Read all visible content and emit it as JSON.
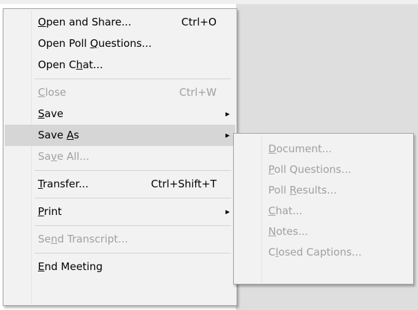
{
  "main_menu": [
    {
      "type": "item",
      "pre": "",
      "key": "O",
      "post": "pen and Share...",
      "shortcut": "Ctrl+O",
      "submenu": false,
      "disabled": false,
      "name": "menu-item-open-and-share"
    },
    {
      "type": "item",
      "pre": "Open Poll ",
      "key": "Q",
      "post": "uestions...",
      "shortcut": "",
      "submenu": false,
      "disabled": false,
      "name": "menu-item-open-poll-questions"
    },
    {
      "type": "item",
      "pre": "Open C",
      "key": "h",
      "post": "at...",
      "shortcut": "",
      "submenu": false,
      "disabled": false,
      "name": "menu-item-open-chat"
    },
    {
      "type": "separator"
    },
    {
      "type": "item",
      "pre": "",
      "key": "C",
      "post": "lose",
      "shortcut": "Ctrl+W",
      "submenu": false,
      "disabled": true,
      "name": "menu-item-close"
    },
    {
      "type": "item",
      "pre": "",
      "key": "S",
      "post": "ave",
      "shortcut": "",
      "submenu": true,
      "disabled": false,
      "name": "menu-item-save"
    },
    {
      "type": "item",
      "pre": "Save ",
      "key": "A",
      "post": "s",
      "shortcut": "",
      "submenu": true,
      "disabled": false,
      "hover": true,
      "name": "menu-item-save-as"
    },
    {
      "type": "item",
      "pre": "Sa",
      "key": "v",
      "post": "e All...",
      "shortcut": "",
      "submenu": false,
      "disabled": true,
      "name": "menu-item-save-all"
    },
    {
      "type": "separator"
    },
    {
      "type": "item",
      "pre": "",
      "key": "T",
      "post": "ransfer...",
      "shortcut": "Ctrl+Shift+T",
      "submenu": false,
      "disabled": false,
      "name": "menu-item-transfer"
    },
    {
      "type": "separator"
    },
    {
      "type": "item",
      "pre": "",
      "key": "P",
      "post": "rint",
      "shortcut": "",
      "submenu": true,
      "disabled": false,
      "name": "menu-item-print"
    },
    {
      "type": "separator"
    },
    {
      "type": "item",
      "pre": "Se",
      "key": "n",
      "post": "d Transcript...",
      "shortcut": "",
      "submenu": false,
      "disabled": true,
      "name": "menu-item-send-transcript"
    },
    {
      "type": "separator"
    },
    {
      "type": "item",
      "pre": "",
      "key": "E",
      "post": "nd Meeting",
      "shortcut": "",
      "submenu": false,
      "disabled": false,
      "name": "menu-item-end-meeting"
    }
  ],
  "save_as_submenu": [
    {
      "pre": "",
      "key": "D",
      "post": "ocument...",
      "disabled": true,
      "name": "submenu-item-document"
    },
    {
      "pre": "",
      "key": "P",
      "post": "oll Questions...",
      "disabled": true,
      "name": "submenu-item-poll-questions"
    },
    {
      "pre": "Poll ",
      "key": "R",
      "post": "esults...",
      "disabled": true,
      "name": "submenu-item-poll-results"
    },
    {
      "pre": "",
      "key": "C",
      "post": "hat...",
      "disabled": true,
      "name": "submenu-item-chat"
    },
    {
      "pre": "",
      "key": "N",
      "post": "otes...",
      "disabled": true,
      "name": "submenu-item-notes"
    },
    {
      "pre": "C",
      "key": "l",
      "post": "osed Captions...",
      "disabled": true,
      "name": "submenu-item-closed-captions"
    }
  ],
  "icons": {
    "submenu_arrow": "▶"
  }
}
